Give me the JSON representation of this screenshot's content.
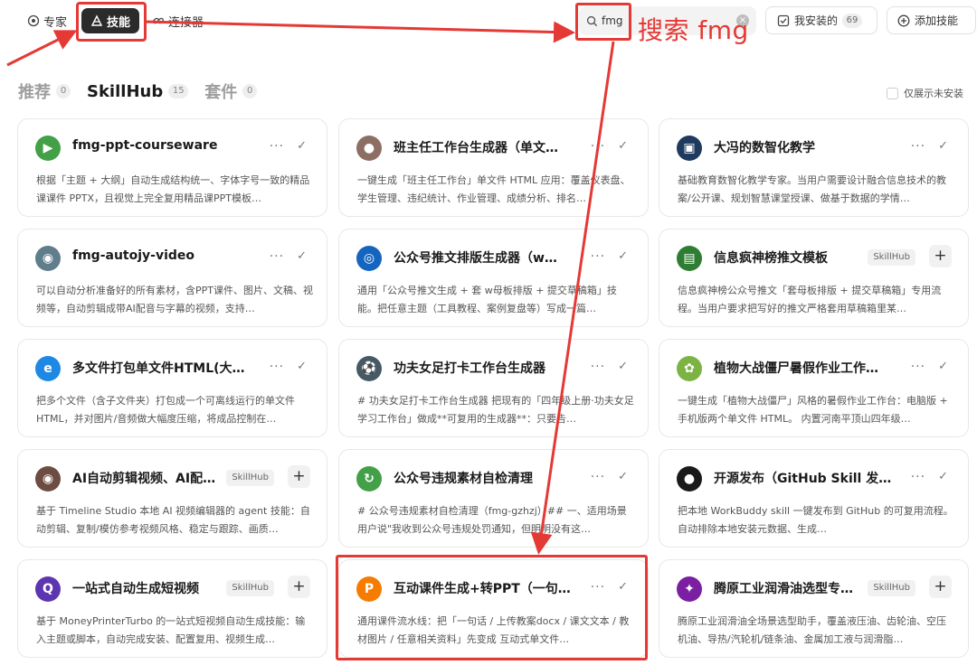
{
  "nav": {
    "expert": "专家",
    "skills": "技能",
    "connector": "连接器"
  },
  "search": {
    "value": "fmg",
    "annotation": "搜索 fmg"
  },
  "toolbar": {
    "installed_label": "我安装的",
    "installed_count": "69",
    "add_label": "添加技能"
  },
  "tabs": [
    {
      "label": "推荐",
      "count": "0"
    },
    {
      "label": "SkillHub",
      "count": "15"
    },
    {
      "label": "套件",
      "count": "0"
    }
  ],
  "filter_label": "仅展示未安装",
  "cards": [
    {
      "title": "fmg-ppt-courseware",
      "desc": "根据「主题 + 大纲」自动生成结构统一、字体字号一致的精品课课件 PPTX，且视觉上完全复用精品课PPT模板…",
      "icon": "green-slides-icon",
      "color": "#43a047",
      "glyph": "▶",
      "state": "installed"
    },
    {
      "title": "班主任工作台生成器（单文…",
      "desc": "一键生成「班主任工作台」单文件 HTML 应用：覆盖仪表盘、学生管理、违纪统计、作业管理、成绩分析、排名…",
      "icon": "teacher-avatar-icon",
      "color": "#8d6e63",
      "glyph": "●",
      "state": "installed"
    },
    {
      "title": "大冯的数智化教学",
      "desc": "基础教育数智化教学专家。当用户需要设计融合信息技术的教案/公开课、规划智慧课堂授课、做基于数据的学情…",
      "icon": "classroom-icon",
      "color": "#1e3a5f",
      "glyph": "▣",
      "state": "installed"
    },
    {
      "title": "fmg-autojy-video",
      "desc": "可以自动分析准备好的所有素材，含PPT课件、图片、文稿、视频等，自动剪辑成带AI配音与字幕的视频，支持…",
      "icon": "film-reel-icon",
      "color": "#607d8b",
      "glyph": "◉",
      "state": "installed"
    },
    {
      "title": "公众号推文排版生成器（w…",
      "desc": "通用「公众号推文生成 + 套 w母板排版 + 提交草稿箱」技能。把任意主题（工具教程、案例复盘等）写成一篇…",
      "icon": "blue-swirl-icon",
      "color": "#1565c0",
      "glyph": "◎",
      "state": "installed"
    },
    {
      "title": "信息疯神榜推文模板",
      "desc": "信息疯神榜公众号推文「套母板排版 + 提交草稿箱」专用流程。当用户要求把写好的推文严格套用草稿箱里某…",
      "icon": "green-doc-icon",
      "color": "#2e7d32",
      "glyph": "▤",
      "state": "add",
      "badge": "SkillHub"
    },
    {
      "title": "多文件打包单文件HTML(大…",
      "desc": "把多个文件（含子文件夹）打包成一个可离线运行的单文件 HTML，并对图片/音频做大幅度压缩，将成品控制在…",
      "icon": "browser-e-icon",
      "color": "#1e88e5",
      "glyph": "e",
      "state": "installed"
    },
    {
      "title": "功夫女足打卡工作台生成器",
      "desc": "# 功夫女足打卡工作台生成器 把现有的「四年级上册·功夫女足学习工作台」做成**可复用的生成器**：只要告…",
      "icon": "soccer-ball-icon",
      "color": "#455a64",
      "glyph": "⚽",
      "state": "installed"
    },
    {
      "title": "植物大战僵尸暑假作业工作…",
      "desc": "一键生成「植物大战僵尸」风格的暑假作业工作台：电脑版 + 手机版两个单文件 HTML。 内置河南平顶山四年级…",
      "icon": "plant-icon",
      "color": "#7cb342",
      "glyph": "✿",
      "state": "installed"
    },
    {
      "title": "AI自动剪辑视频、AI配…",
      "desc": "基于 Timeline Studio 本地 AI 视频编辑器的 agent 技能：自动剪辑、复制/模仿参考视频风格、稳定与跟踪、画质…",
      "icon": "film-reel-icon",
      "color": "#6d4c41",
      "glyph": "◉",
      "state": "add",
      "badge": "SkillHub"
    },
    {
      "title": "公众号违规素材自检清理",
      "desc": "# 公众号违规素材自检清理（fmg-gzhzj）## 一、适用场景 用户说\"我收到公众号违规处罚通知，但明明没有这…",
      "icon": "green-refresh-icon",
      "color": "#43a047",
      "glyph": "↻",
      "state": "installed"
    },
    {
      "title": "开源发布（GitHub Skill 发…",
      "desc": "把本地 WorkBuddy skill 一键发布到 GitHub 的可复用流程。自动排除本地安装元数据、生成…",
      "icon": "github-icon",
      "color": "#1a1a1a",
      "glyph": "●",
      "state": "installed"
    },
    {
      "title": "一站式自动生成短视频",
      "desc": "基于 MoneyPrinterTurbo 的一站式短视频自动生成技能：输入主题或脚本，自动完成安装、配置复用、视频生成…",
      "icon": "purple-q-icon",
      "color": "#5e35b1",
      "glyph": "Q",
      "state": "add",
      "badge": "SkillHub"
    },
    {
      "title": "互动课件生成+转PPT（一句…",
      "desc": "通用课件流水线：把「一句话 / 上传教案docx / 课文文本 / 教材图片 / 任意相关资料」先变成 互动式单文件…",
      "icon": "orange-p-icon",
      "color": "#f57c00",
      "glyph": "P",
      "state": "installed"
    },
    {
      "title": "腾原工业润滑油选型专…",
      "desc": "腾原工业润滑油全场景选型助手，覆盖液压油、齿轮油、空压机油、导热/汽轮机/链条油、金属加工液与润滑脂…",
      "icon": "purple-star-icon",
      "color": "#7b1fa2",
      "glyph": "✦",
      "state": "add",
      "badge": "SkillHub"
    }
  ]
}
